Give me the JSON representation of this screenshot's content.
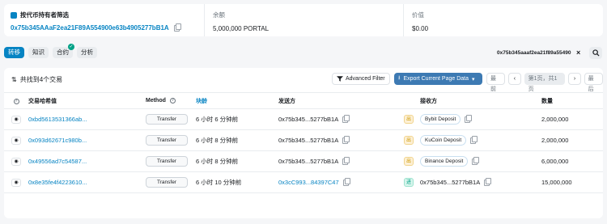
{
  "filter": {
    "title": "按代币持有者筛选",
    "address": "0x75b345AAaF2ea21F89A554900e63b4905277bB1A"
  },
  "balance": {
    "label": "余额",
    "value": "5,000,000 PORTAL"
  },
  "worth": {
    "label": "价值",
    "value": "$0.00"
  },
  "tabs": [
    {
      "label": "转移",
      "active": true
    },
    {
      "label": "知识"
    },
    {
      "label": "合约",
      "verified": true
    },
    {
      "label": "分析"
    }
  ],
  "chip": {
    "text": "0x75b345aaaf2ea21f89a55490",
    "close": "×"
  },
  "summary": {
    "text": "共找到4个交易"
  },
  "toolbar": {
    "advanced_filter": "Advanced Filter",
    "export": "Export Current Page Data"
  },
  "pager": {
    "first": "最前",
    "prev": "‹",
    "info": "第1页，共1页",
    "next": "›",
    "last": "最后"
  },
  "columns": {
    "hash": "交易哈希值",
    "method": "Method",
    "block": "块龄",
    "from": "发送方",
    "to": "接收方",
    "amount": "数量"
  },
  "rows": [
    {
      "hash": "0xbd5613531366ab...",
      "method": "Transfer",
      "age": "6 小时 6 分钟前",
      "from": "0x75b345...5277bB1A",
      "dir": "出",
      "to": "Bybit Deposit",
      "amount": "2,000,000"
    },
    {
      "hash": "0x093d62671c980b...",
      "method": "Transfer",
      "age": "6 小时 8 分钟前",
      "from": "0x75b345...5277bB1A",
      "dir": "出",
      "to": "KuCoin Deposit",
      "amount": "2,000,000"
    },
    {
      "hash": "0x49556ad7c54587...",
      "method": "Transfer",
      "age": "6 小时 8 分钟前",
      "from": "0x75b345...5277bB1A",
      "dir": "出",
      "to": "Binance Deposit",
      "amount": "6,000,000"
    },
    {
      "hash": "0x8e35fe4f4223610...",
      "method": "Transfer",
      "age": "6 小时 10 分钟前",
      "from": "0x3cC993...84397C47",
      "dir": "进",
      "to": "0x75b345...5277bB1A",
      "amount": "15,000,000"
    }
  ],
  "colors": {
    "accent": "#0784c3",
    "export": "#3d7ab3",
    "out": "#cc9a06",
    "in": "#00a186"
  }
}
